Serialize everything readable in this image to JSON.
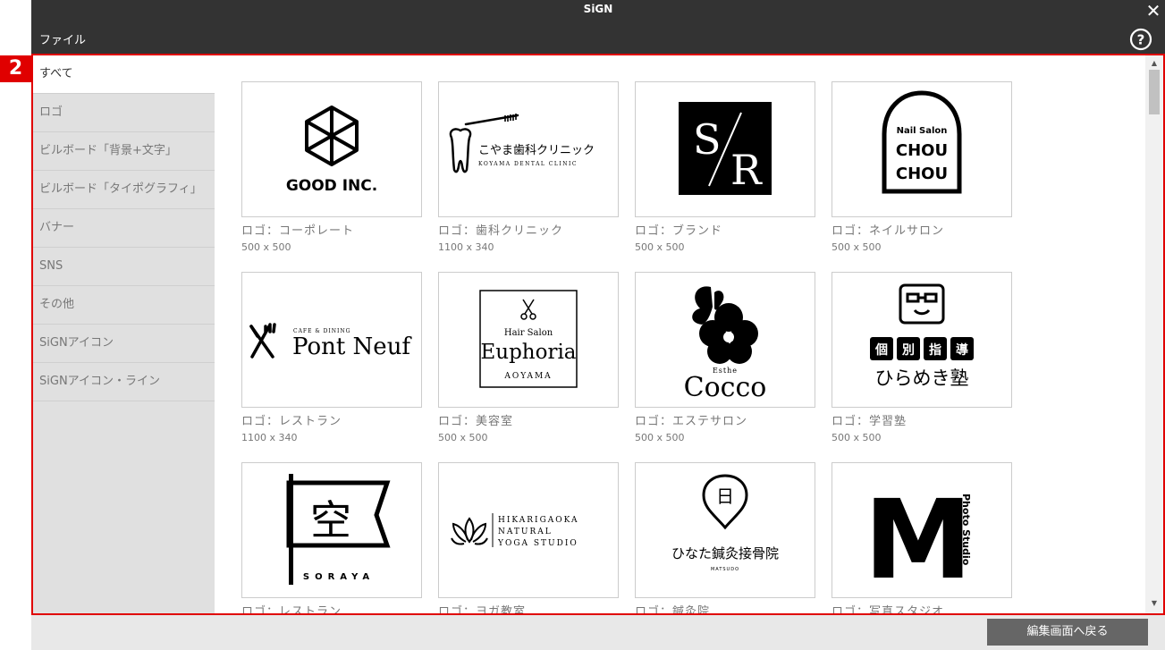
{
  "window": {
    "title": "SiGN"
  },
  "menu": {
    "file": "ファイル"
  },
  "badge": "2",
  "sidebar": {
    "items": [
      {
        "label": "すべて"
      },
      {
        "label": "ロゴ"
      },
      {
        "label": "ビルボード「背景+文字」"
      },
      {
        "label": "ビルボード「タイポグラフィ」"
      },
      {
        "label": "バナー"
      },
      {
        "label": "SNS"
      },
      {
        "label": "その他"
      },
      {
        "label": "SiGNアイコン"
      },
      {
        "label": "SiGNアイコン・ライン"
      }
    ]
  },
  "templates": [
    {
      "title": "ロゴ：コーポレート",
      "size": "500 x 500",
      "logo": {
        "text": "GOOD INC."
      }
    },
    {
      "title": "ロゴ：歯科クリニック",
      "size": "1100 x 340",
      "logo": {
        "text": "こやま歯科クリニック",
        "sub": "KOYAMA DENTAL CLINIC"
      }
    },
    {
      "title": "ロゴ：ブランド",
      "size": "500 x 500",
      "logo": {
        "text1": "S",
        "text2": "R"
      }
    },
    {
      "title": "ロゴ：ネイルサロン",
      "size": "500 x 500",
      "logo": {
        "sub": "Nail Salon",
        "text1": "CHOU",
        "text2": "CHOU"
      }
    },
    {
      "title": "ロゴ：レストラン",
      "size": "1100 x 340",
      "logo": {
        "sub": "CAFE & DINING",
        "text": "Pont Neuf"
      }
    },
    {
      "title": "ロゴ：美容室",
      "size": "500 x 500",
      "logo": {
        "sub": "Hair Salon",
        "text": "Euphoria",
        "sub2": "AOYAMA"
      }
    },
    {
      "title": "ロゴ：エステサロン",
      "size": "500 x 500",
      "logo": {
        "sub": "Esthe",
        "text": "Cocco"
      }
    },
    {
      "title": "ロゴ：学習塾",
      "size": "500 x 500",
      "logo": {
        "chars": [
          "個",
          "別",
          "指",
          "導"
        ],
        "text": "ひらめき塾"
      }
    },
    {
      "title": "ロゴ：レストラン",
      "size": "",
      "logo": {
        "char": "空",
        "sub": "SORAYA"
      }
    },
    {
      "title": "ロゴ：ヨガ教室",
      "size": "",
      "logo": {
        "line1": "HIKARIGAOKA",
        "line2": "NATURAL",
        "line3": "YOGA STUDIO"
      }
    },
    {
      "title": "ロゴ：鍼灸院",
      "size": "",
      "logo": {
        "char": "日",
        "text": "ひなた鍼灸接骨院",
        "sub": "MATSUDO"
      }
    },
    {
      "title": "ロゴ：写真スタジオ",
      "size": "",
      "logo": {
        "char": "M",
        "side": "Photo Studio"
      }
    }
  ],
  "footer": {
    "back_button": "編集画面へ戻る"
  },
  "colors": {
    "titlebar": "#333333",
    "highlight": "#e00000",
    "sidebar": "#e0e0e0",
    "button": "#666666"
  }
}
